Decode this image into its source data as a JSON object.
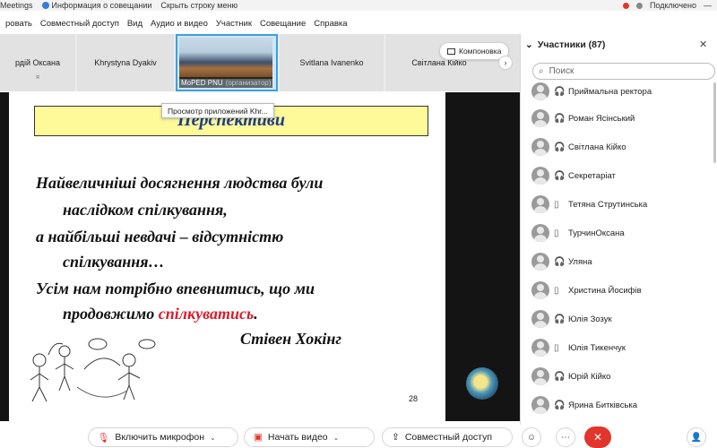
{
  "topbar": {
    "app_name": "Meetings",
    "info_label": "Информация о совещании",
    "hide_bar_label": "Скрыть строку меню",
    "status": "Подключено"
  },
  "menu": [
    "Совместный доступ",
    "Вид",
    "Аудио и видео",
    "Участник",
    "Совещание",
    "Справка"
  ],
  "menu_partial": "ровать",
  "strip": {
    "tiles": [
      {
        "name": "рдій Оксана",
        "sub": "я"
      },
      {
        "name": "Khrystyna Dyakiv",
        "sub": ""
      },
      {
        "name": "MoPED PNU",
        "role": "(организатор)"
      },
      {
        "name": "Svitlana Ivanenko",
        "sub": ""
      },
      {
        "name": "Світлана Кійко",
        "sub": ""
      }
    ],
    "layout_button": "Компоновка"
  },
  "slide": {
    "title": "Перспективи",
    "lines": [
      "Найвеличніші досягнення людства були",
      "наслідком спілкування,",
      "а найбільші невдачі – відсутністю",
      "спілкування…",
      "Усім нам потрібно впевнитись, що ми",
      "продовжимо ",
      "спілкуватись",
      ".",
      "Стівен Хокінг"
    ],
    "page_number": "28",
    "tooltip": "Просмотр приложений Khr..."
  },
  "toolbar": {
    "mic": "Включить микрофон",
    "video": "Начать видео",
    "share": "Совместный доступ"
  },
  "participants": {
    "title": "Участники (87)",
    "search_placeholder": "Поиск",
    "items": [
      {
        "name": "Приймальна ректора",
        "device": "headset-icon"
      },
      {
        "name": "Роман Ясінський",
        "device": "headset-icon"
      },
      {
        "name": "Світлана Кійко",
        "device": "headset-icon"
      },
      {
        "name": "Секретаріат",
        "device": "headset-icon"
      },
      {
        "name": "Тетяна Струтинська",
        "device": "phone-icon"
      },
      {
        "name": "ТурчинОксана",
        "device": "phone-icon"
      },
      {
        "name": "Уляна",
        "device": "headset-icon"
      },
      {
        "name": "Христина Йосифів",
        "device": "phone-icon"
      },
      {
        "name": "Юлія Зозук",
        "device": "headset-icon"
      },
      {
        "name": "Юлія Тикенчук",
        "device": "phone-icon"
      },
      {
        "name": "Юрій Кійко",
        "device": "headset-icon"
      },
      {
        "name": "Ярина Битківська",
        "device": "headset-icon"
      }
    ]
  },
  "colors": {
    "accent": "#3aa0e0",
    "slide_title_bg": "#fefa9a",
    "slide_title_fg": "#1f3d8a",
    "highlight_red": "#d81b2a",
    "end_button": "#e0362b"
  }
}
